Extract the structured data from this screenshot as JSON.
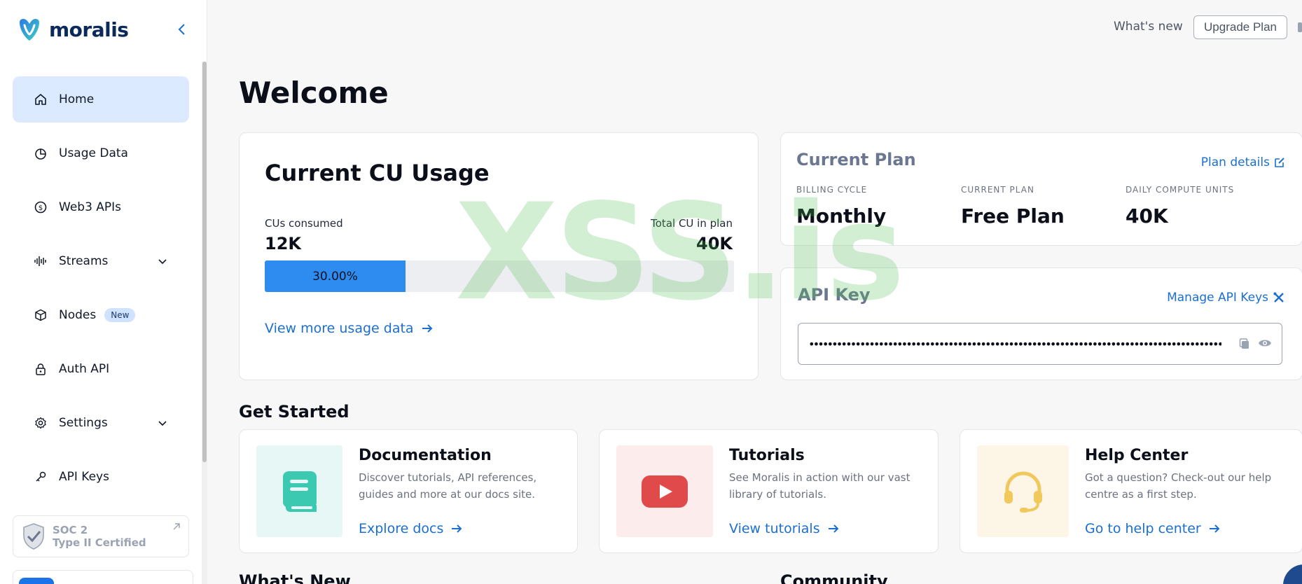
{
  "brand": {
    "name": "moralis"
  },
  "sidebar": {
    "items": [
      {
        "label": "Home",
        "icon": "home-icon",
        "active": true
      },
      {
        "label": "Usage Data",
        "icon": "pie-chart-icon"
      },
      {
        "label": "Web3 APIs",
        "icon": "coin-icon"
      },
      {
        "label": "Streams",
        "icon": "waveform-icon",
        "expandable": true
      },
      {
        "label": "Nodes",
        "icon": "cube-icon",
        "badge": "New"
      },
      {
        "label": "Auth API",
        "icon": "lock-icon"
      },
      {
        "label": "Settings",
        "icon": "gear-icon",
        "expandable": true
      },
      {
        "label": "API Keys",
        "icon": "key-icon"
      }
    ],
    "soc": {
      "line1": "SOC 2",
      "line2": "Type II Certified"
    }
  },
  "topbar": {
    "whats_new": "What's new",
    "upgrade": "Upgrade Plan"
  },
  "page": {
    "title": "Welcome",
    "get_started": "Get Started",
    "whats_new_section": "What's New",
    "community_section": "Community"
  },
  "cu_usage": {
    "title": "Current CU Usage",
    "consumed_label": "CUs consumed",
    "consumed_value": "12K",
    "total_label": "Total CU in plan",
    "total_value": "40K",
    "percent_label": "30.00%",
    "percent": 30.0,
    "more_link": "View more usage data"
  },
  "plan": {
    "title": "Current Plan",
    "details_link": "Plan details",
    "columns": [
      {
        "label": "BILLING CYCLE",
        "value": "Monthly"
      },
      {
        "label": "CURRENT PLAN",
        "value": "Free Plan"
      },
      {
        "label": "DAILY COMPUTE UNITS",
        "value": "40K"
      }
    ]
  },
  "api_key": {
    "title": "API Key",
    "manage_link": "Manage API Keys",
    "masked_value": "••••••••••••••••••••••••••••••••••••••••••••••••••••••••••••••••••••••••••••••••••••••••••"
  },
  "get_started_cards": [
    {
      "title": "Documentation",
      "description": "Discover tutorials, API references, guides and more at our docs site.",
      "link": "Explore docs",
      "icon": "book-icon",
      "bg": "#e6f7f5"
    },
    {
      "title": "Tutorials",
      "description": "See Moralis in action with our vast library of tutorials.",
      "link": "View tutorials",
      "icon": "play-icon",
      "bg": "#fdecec"
    },
    {
      "title": "Help Center",
      "description": "Got a question? Check-out our help centre as a first step.",
      "link": "Go to help center",
      "icon": "headset-icon",
      "bg": "#fdf6e6"
    }
  ],
  "watermark": "XSS.is",
  "colors": {
    "accent": "#1a6fd1",
    "bar": "#2e8cf0",
    "active_nav": "#dbeafe"
  }
}
